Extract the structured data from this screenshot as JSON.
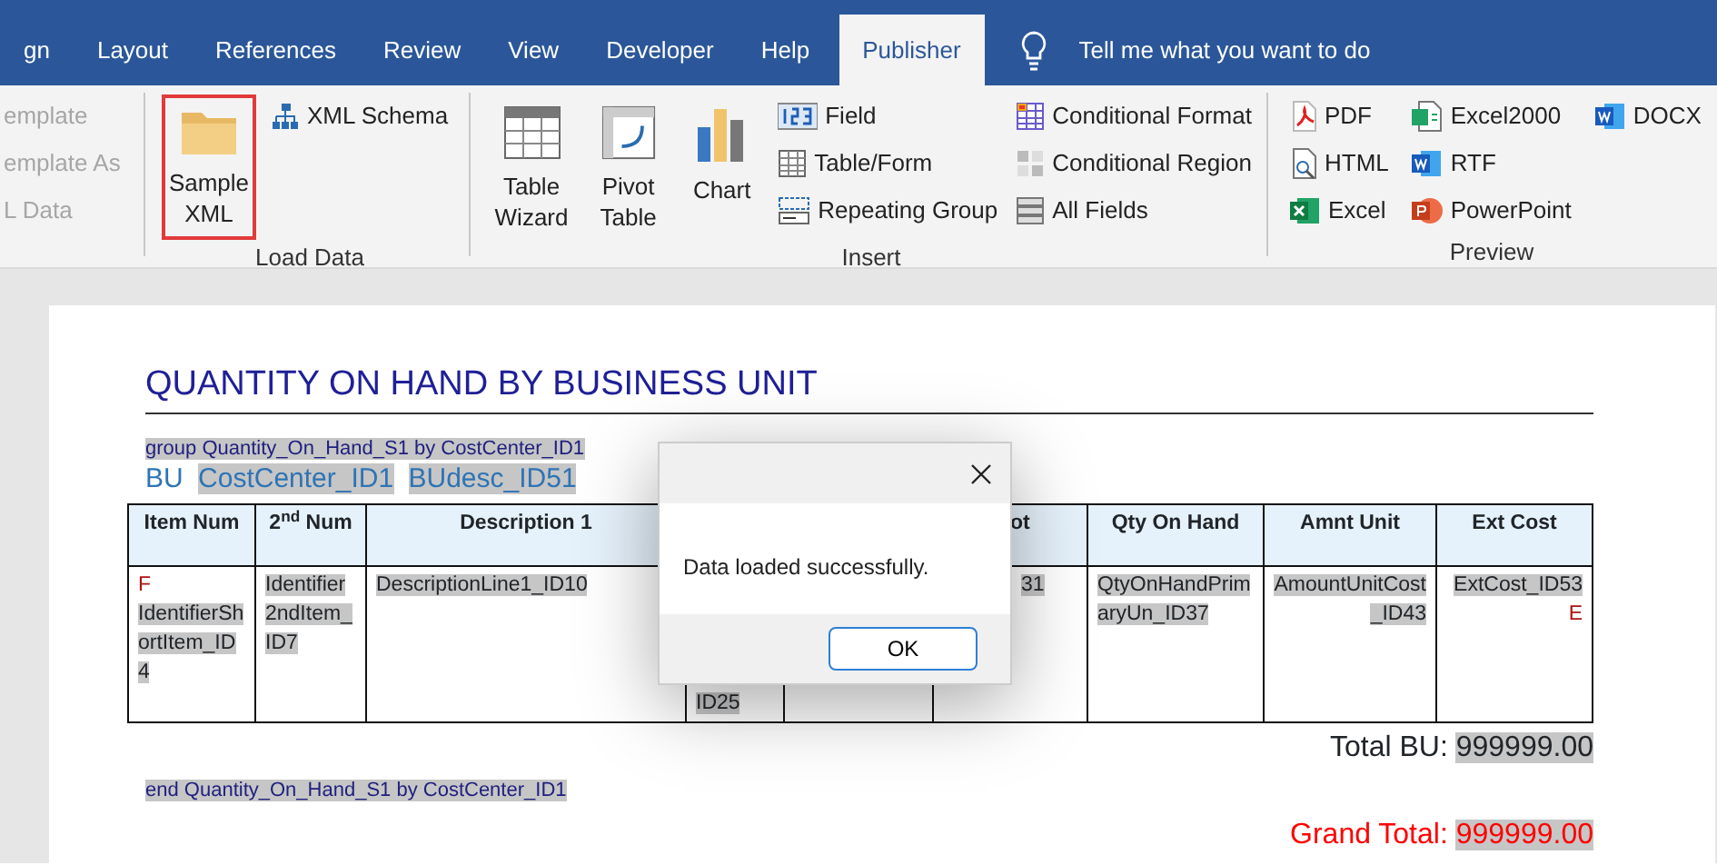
{
  "ribbon_tabs": [
    {
      "label": "gn",
      "selected": false
    },
    {
      "label": "Layout",
      "selected": false
    },
    {
      "label": "References",
      "selected": false
    },
    {
      "label": "Review",
      "selected": false
    },
    {
      "label": "View",
      "selected": false
    },
    {
      "label": "Developer",
      "selected": false
    },
    {
      "label": "Help",
      "selected": false
    },
    {
      "label": "Publisher",
      "selected": true
    }
  ],
  "tell_me": "Tell me what you want to do",
  "ribbon_groups": [
    {
      "items": [
        {
          "kind": "small",
          "label": "emplate",
          "disabled": true
        },
        {
          "kind": "small",
          "label": "emplate As",
          "disabled": true
        },
        {
          "kind": "small",
          "label": "L Data",
          "disabled": true
        }
      ]
    },
    {
      "label": "Load Data",
      "items": [
        {
          "kind": "large",
          "label": "Sample XML",
          "disabled": false,
          "highlighted": true
        },
        {
          "kind": "small",
          "label": "XML Schema",
          "disabled": false
        }
      ]
    },
    {
      "label": "Insert",
      "items": [
        {
          "kind": "large",
          "label": "Table Wizard",
          "disabled": false,
          "highlighted": false
        },
        {
          "kind": "large",
          "label": "Pivot Table",
          "disabled": false,
          "highlighted": false
        },
        {
          "kind": "large",
          "label": "Chart",
          "disabled": false,
          "highlighted": false
        },
        {
          "kind": "small",
          "label": "Field",
          "disabled": false
        },
        {
          "kind": "small",
          "label": "Table/Form",
          "disabled": false
        },
        {
          "kind": "small",
          "label": "Repeating Group",
          "disabled": false
        },
        {
          "kind": "small",
          "label": "Conditional Format",
          "disabled": false
        },
        {
          "kind": "small",
          "label": "Conditional Region",
          "disabled": false
        },
        {
          "kind": "small",
          "label": "All Fields",
          "disabled": false
        }
      ]
    },
    {
      "label": "Preview",
      "items": [
        {
          "kind": "small",
          "label": "PDF",
          "disabled": false
        },
        {
          "kind": "small",
          "label": "HTML",
          "disabled": false
        },
        {
          "kind": "small",
          "label": "Excel",
          "disabled": false
        },
        {
          "kind": "small",
          "label": "Excel2000",
          "disabled": false
        },
        {
          "kind": "small",
          "label": "RTF",
          "disabled": false
        },
        {
          "kind": "small",
          "label": "PowerPoint",
          "disabled": false
        },
        {
          "kind": "small",
          "label": "DOCX",
          "disabled": false
        }
      ]
    }
  ],
  "document": {
    "title": "QUANTITY ON HAND BY BUSINESS UNIT",
    "group_start": "group Quantity_On_Hand_S1 by CostCenter_ID1",
    "bu_label": "BU",
    "bu_fields": [
      "CostCenter_ID1",
      "BUdesc_ID51"
    ],
    "table": {
      "columns": [
        {
          "label": "Item Num"
        },
        {
          "label": "2$^{nd}$ Num"
        },
        {
          "label": "Description 1"
        },
        {},
        {},
        {
          "label": "ot"
        },
        {
          "label": "Qty On Hand"
        },
        {
          "label": "Amnt Unit"
        },
        {
          "label": "Ext Cost"
        }
      ],
      "rows": [
        [
          {
            "flag_before": "F",
            "text": "IdentifierShortItem_ID4"
          },
          {
            "text": "Identifier2ndItem_ID7"
          },
          {
            "text": "DescriptionLine1_ID10"
          },
          {
            "text": "ID25",
            "at_bottom": true,
            "right_aligned": false
          },
          {},
          {
            "text": "31"
          },
          {
            "text": "QtyOnHandPrimaryUn_ID37"
          },
          {
            "text": "AmountUnitCost_ID43",
            "right_aligned": true
          },
          {
            "text": "ExtCost_ID53",
            "flag_after": "E",
            "right_aligned": true
          }
        ]
      ]
    },
    "total_bu_label": "Total BU:",
    "total_bu_value": "999999.00",
    "group_end": "end Quantity_On_Hand_S1 by CostCenter_ID1",
    "grand_total_label": "Grand Total:",
    "grand_total_value": "999999.00"
  },
  "dialog": {
    "message": "Data loaded successfully.",
    "buttons": [
      "OK"
    ]
  }
}
